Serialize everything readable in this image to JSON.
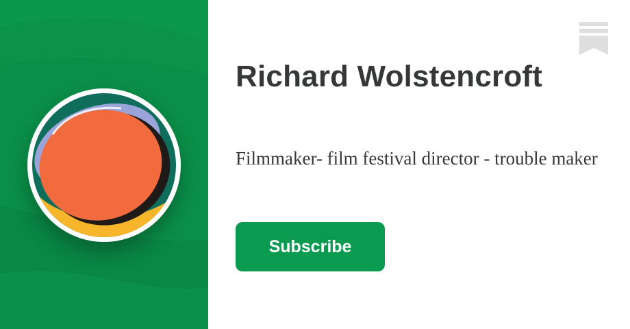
{
  "profile": {
    "name": "Richard Wolstencroft",
    "description": "Filmmaker- film festival director - trouble maker"
  },
  "actions": {
    "subscribe_label": "Subscribe"
  },
  "icons": {
    "avatar": "profile-avatar",
    "bookmark": "bookmark-icon"
  },
  "colors": {
    "brand_green": "#0a9a50",
    "panel_green": "#0a8f48",
    "text": "#363737",
    "avatar_orange": "#f26b3f",
    "avatar_yellow": "#f7b52c",
    "avatar_lavender": "#9aa4d8",
    "avatar_teal": "#0f6e5b"
  }
}
